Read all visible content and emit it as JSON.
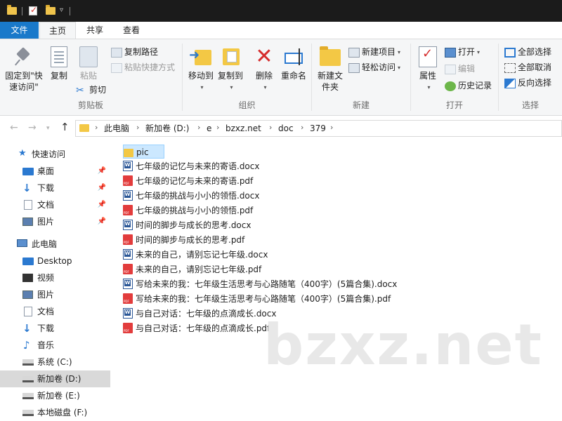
{
  "titlebar": {
    "quick_access": [
      "folder-icon",
      "properties-icon",
      "new-folder-icon",
      "customize-dropdown-icon"
    ]
  },
  "tabs": {
    "file": "文件",
    "home": "主页",
    "share": "共享",
    "view": "查看"
  },
  "ribbon": {
    "clipboard": {
      "pin_label": "固定到\"快速访问\"",
      "copy_label": "复制",
      "paste_label": "粘贴",
      "copy_path": "复制路径",
      "paste_shortcut": "粘贴快捷方式",
      "cut": "剪切",
      "group_label": "剪贴板"
    },
    "organize": {
      "move_to": "移动到",
      "copy_to": "复制到",
      "delete": "删除",
      "rename": "重命名",
      "group_label": "组织"
    },
    "new": {
      "new_folder": "新建文件夹",
      "new_item": "新建项目",
      "easy_access": "轻松访问",
      "group_label": "新建"
    },
    "open": {
      "properties": "属性",
      "open": "打开",
      "edit": "编辑",
      "history": "历史记录",
      "group_label": "打开"
    },
    "select": {
      "select_all": "全部选择",
      "select_none": "全部取消",
      "invert": "反向选择",
      "group_label": "选择"
    }
  },
  "address": {
    "crumbs": [
      "此电脑",
      "新加卷 (D:)",
      "e",
      "bzxz.net",
      "doc",
      "379"
    ]
  },
  "nav": {
    "quick_access": "快速访问",
    "desktop": "桌面",
    "downloads": "下载",
    "documents": "文档",
    "pictures": "图片",
    "this_pc": "此电脑",
    "desktop_en": "Desktop",
    "videos": "视频",
    "pictures2": "图片",
    "documents2": "文档",
    "downloads2": "下载",
    "music": "音乐",
    "drive_c": "系统 (C:)",
    "drive_d": "新加卷 (D:)",
    "drive_e": "新加卷 (E:)",
    "drive_f": "本地磁盘 (F:)"
  },
  "files": [
    {
      "name": "pic",
      "type": "folder"
    },
    {
      "name": "七年级的记忆与未来的寄语.docx",
      "type": "docx"
    },
    {
      "name": "七年级的记忆与未来的寄语.pdf",
      "type": "pdf"
    },
    {
      "name": "七年级的挑战与小小的领悟.docx",
      "type": "docx"
    },
    {
      "name": "七年级的挑战与小小的领悟.pdf",
      "type": "pdf"
    },
    {
      "name": "时间的脚步与成长的思考.docx",
      "type": "docx"
    },
    {
      "name": "时间的脚步与成长的思考.pdf",
      "type": "pdf"
    },
    {
      "name": "未来的自己，请别忘记七年级.docx",
      "type": "docx"
    },
    {
      "name": "未来的自己，请别忘记七年级.pdf",
      "type": "pdf"
    },
    {
      "name": "写给未来的我：七年级生活思考与心路随笔（400字）(5篇合集).docx",
      "type": "docx"
    },
    {
      "name": "写给未来的我：七年级生活思考与心路随笔（400字）(5篇合集).pdf",
      "type": "pdf"
    },
    {
      "name": "与自己对话：七年级的点滴成长.docx",
      "type": "docx"
    },
    {
      "name": "与自己对话：七年级的点滴成长.pdf",
      "type": "pdf"
    }
  ],
  "watermark": "bzxz.net"
}
